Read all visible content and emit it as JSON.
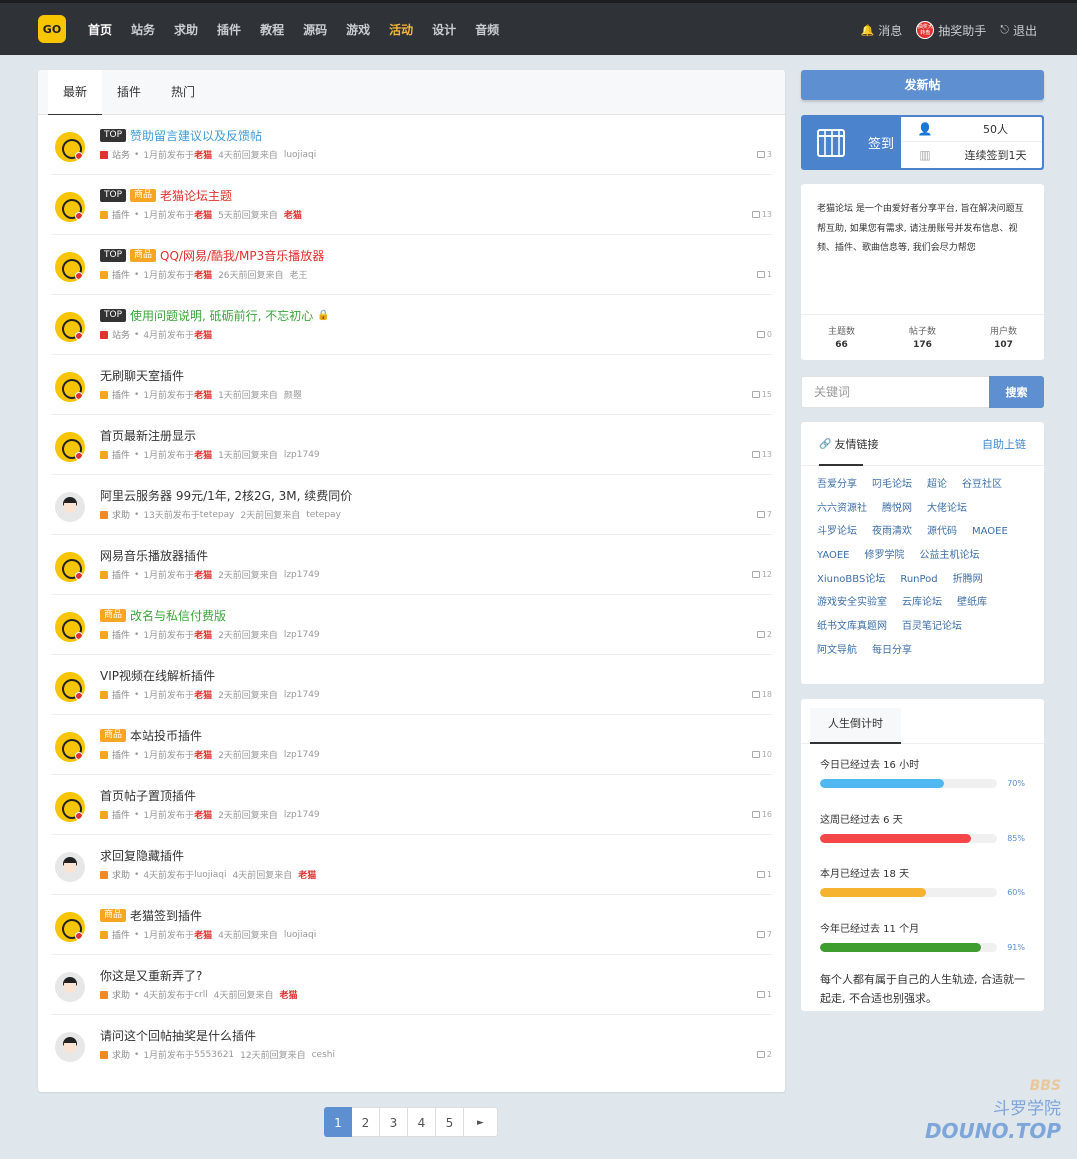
{
  "nav": {
    "logo_text": "GO",
    "items": [
      "首页",
      "站务",
      "求助",
      "插件",
      "教程",
      "源码",
      "游戏",
      "活动",
      "设计",
      "音频"
    ],
    "messages": "消息",
    "lottery_badge": "抽奖大转盘",
    "lottery": "抽奖助手",
    "logout": "退出"
  },
  "tabs": [
    "最新",
    "插件",
    "热门"
  ],
  "threads": [
    {
      "avatar": "cat",
      "tags": [
        "TOP"
      ],
      "title": "赞助留言建议以及反馈帖",
      "title_color": "blue",
      "cat_color": "#e0322e",
      "forum": "站务",
      "posted": "1月前发布于",
      "poster": "老猫",
      "poster_red": true,
      "reply": "4天前回复来自",
      "replier": "luojiaqi",
      "replier_red": false,
      "replies": "3"
    },
    {
      "avatar": "cat",
      "tags": [
        "TOP",
        "商品"
      ],
      "title": "老猫论坛主题",
      "title_color": "red",
      "cat_color": "#f6a623",
      "forum": "插件",
      "posted": "1月前发布于",
      "poster": "老猫",
      "poster_red": true,
      "reply": "5天前回复来自",
      "replier": "老猫",
      "replier_red": true,
      "replies": "13"
    },
    {
      "avatar": "cat",
      "tags": [
        "TOP",
        "商品"
      ],
      "title": "QQ/网易/酷我/MP3音乐播放器",
      "title_color": "red",
      "cat_color": "#f6a623",
      "forum": "插件",
      "posted": "1月前发布于",
      "poster": "老猫",
      "poster_red": true,
      "reply": "26天前回复来自",
      "replier": "老王",
      "replier_red": false,
      "replies": "1"
    },
    {
      "avatar": "cat",
      "tags": [
        "TOP"
      ],
      "title": "使用问题说明, 砥砺前行, 不忘初心",
      "title_color": "green",
      "lock": true,
      "cat_color": "#e0322e",
      "forum": "站务",
      "posted": "4月前发布于",
      "poster": "老猫",
      "poster_red": true,
      "reply": "",
      "replier": "",
      "replier_red": false,
      "replies": "0"
    },
    {
      "avatar": "cat",
      "tags": [],
      "title": "无刷聊天室插件",
      "title_color": "",
      "cat_color": "#f6a623",
      "forum": "插件",
      "posted": "1月前发布于",
      "poster": "老猫",
      "poster_red": true,
      "reply": "1天前回复来自",
      "replier": "颜瞾",
      "replier_red": false,
      "replies": "15"
    },
    {
      "avatar": "cat",
      "tags": [],
      "title": "首页最新注册显示",
      "title_color": "",
      "cat_color": "#f6a623",
      "forum": "插件",
      "posted": "1月前发布于",
      "poster": "老猫",
      "poster_red": true,
      "reply": "1天前回复来自",
      "replier": "lzp1749",
      "replier_red": false,
      "replies": "13"
    },
    {
      "avatar": "person",
      "tags": [],
      "title": "阿里云服务器 99元/1年, 2核2G, 3M, 续费同价",
      "title_color": "",
      "cat_color": "#f08a24",
      "forum": "求助",
      "posted": "13天前发布于",
      "poster": "tetepay",
      "poster_red": false,
      "reply": "2天前回复来自",
      "replier": "tetepay",
      "replier_red": false,
      "replies": "7"
    },
    {
      "avatar": "cat",
      "tags": [],
      "title": "网易音乐播放器插件",
      "title_color": "",
      "cat_color": "#f6a623",
      "forum": "插件",
      "posted": "1月前发布于",
      "poster": "老猫",
      "poster_red": true,
      "reply": "2天前回复来自",
      "replier": "lzp1749",
      "replier_red": false,
      "replies": "12"
    },
    {
      "avatar": "cat",
      "tags": [
        "商品"
      ],
      "title": "改名与私信付费版",
      "title_color": "green",
      "cat_color": "#f6a623",
      "forum": "插件",
      "posted": "1月前发布于",
      "poster": "老猫",
      "poster_red": true,
      "reply": "2天前回复来自",
      "replier": "lzp1749",
      "replier_red": false,
      "replies": "2"
    },
    {
      "avatar": "cat",
      "tags": [],
      "title": "VIP视频在线解析插件",
      "title_color": "",
      "cat_color": "#f6a623",
      "forum": "插件",
      "posted": "1月前发布于",
      "poster": "老猫",
      "poster_red": true,
      "reply": "2天前回复来自",
      "replier": "lzp1749",
      "replier_red": false,
      "replies": "18"
    },
    {
      "avatar": "cat",
      "tags": [
        "商品"
      ],
      "title": "本站投币插件",
      "title_color": "",
      "cat_color": "#f6a623",
      "forum": "插件",
      "posted": "1月前发布于",
      "poster": "老猫",
      "poster_red": true,
      "reply": "2天前回复来自",
      "replier": "lzp1749",
      "replier_red": false,
      "replies": "10"
    },
    {
      "avatar": "cat",
      "tags": [],
      "title": "首页帖子置顶插件",
      "title_color": "",
      "cat_color": "#f6a623",
      "forum": "插件",
      "posted": "1月前发布于",
      "poster": "老猫",
      "poster_red": true,
      "reply": "2天前回复来自",
      "replier": "lzp1749",
      "replier_red": false,
      "replies": "16"
    },
    {
      "avatar": "person",
      "tags": [],
      "title": "求回复隐藏插件",
      "title_color": "",
      "cat_color": "#f08a24",
      "forum": "求助",
      "posted": "4天前发布于",
      "poster": "luojiaqi",
      "poster_red": false,
      "reply": "4天前回复来自",
      "replier": "老猫",
      "replier_red": true,
      "replies": "1"
    },
    {
      "avatar": "cat",
      "tags": [
        "商品"
      ],
      "title": "老猫签到插件",
      "title_color": "",
      "cat_color": "#f6a623",
      "forum": "插件",
      "posted": "1月前发布于",
      "poster": "老猫",
      "poster_red": true,
      "reply": "4天前回复来自",
      "replier": "luojiaqi",
      "replier_red": false,
      "replies": "7"
    },
    {
      "avatar": "person",
      "tags": [],
      "title": "你这是又重新弄了?",
      "title_color": "",
      "cat_color": "#f08a24",
      "forum": "求助",
      "posted": "4天前发布于",
      "poster": "crll",
      "poster_red": false,
      "reply": "4天前回复来自",
      "replier": "老猫",
      "replier_red": true,
      "replies": "1"
    },
    {
      "avatar": "person",
      "tags": [],
      "title": "请问这个回帖抽奖是什么插件",
      "title_color": "",
      "cat_color": "#f08a24",
      "forum": "求助",
      "posted": "1月前发布于",
      "poster": "5553621",
      "poster_red": false,
      "reply": "12天前回复来自",
      "replier": "ceshi",
      "replier_red": false,
      "replies": "2"
    }
  ],
  "pager": [
    "1",
    "2",
    "3",
    "4",
    "5",
    "►"
  ],
  "sidebar": {
    "new_post": "发新帖",
    "signin_label": "签到",
    "signin_count": "50人",
    "signin_streak": "连续签到1天",
    "about_text": "老猫论坛 是一个由爱好者分享平台, 旨在解决问题互帮互助, 如果您有需求, 请注册账号并发布信息、视频、插件、歌曲信息等, 我们会尽力帮您",
    "stats": [
      {
        "label": "主题数",
        "value": "66"
      },
      {
        "label": "帖子数",
        "value": "176"
      },
      {
        "label": "用户数",
        "value": "107"
      }
    ],
    "search_placeholder": "关键词",
    "search_button": "搜索",
    "links_title": "友情链接",
    "links_apply": "自助上链",
    "links": [
      "吾爱分享",
      "叼毛论坛",
      "超论",
      "谷豆社区",
      "六六资源社",
      "腾悦网",
      "大佬论坛",
      "斗罗论坛",
      "夜雨清欢",
      "源代码",
      "MAOEE",
      "YAOEE",
      "修罗学院",
      "公益主机论坛",
      "XiunoBBS论坛",
      "RunPod",
      "折腾网",
      "游戏安全实验室",
      "云库论坛",
      "壁纸库",
      "纸书文库真题网",
      "百灵笔记论坛",
      "阿文导航",
      "每日分享"
    ],
    "life_title": "人生倒计时",
    "life": [
      {
        "label": "今日已经过去  16  小时",
        "percent": 70,
        "pct_text": "70%",
        "color": "#4fb8f0"
      },
      {
        "label": "这周已经过去  6  天",
        "percent": 85,
        "pct_text": "85%",
        "color": "#f5464a"
      },
      {
        "label": "本月已经过去  18  天",
        "percent": 60,
        "pct_text": "60%",
        "color": "#f5b330"
      },
      {
        "label": "今年已经过去  11  个月",
        "percent": 91,
        "pct_text": "91%",
        "color": "#3f9c2e"
      }
    ],
    "life_motto": "每个人都有属于自己的人生轨迹, 合适就一起走, 不合适也别强求。"
  },
  "watermark": {
    "bbs": "BBS",
    "cn": "斗罗学院",
    "en": "DOUNO.TOP"
  }
}
